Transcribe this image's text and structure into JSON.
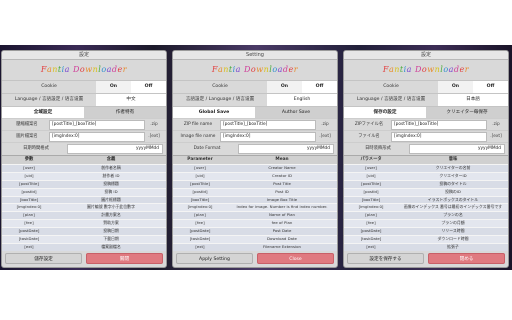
{
  "logo_text": "Fantia Downloader",
  "logo_colors": [
    "#e23c3c",
    "#e88a2a",
    "#d9c21d",
    "#4aab3c",
    "#2f8fd0",
    "#7a4ad0",
    "#d0409a"
  ],
  "panels": [
    {
      "title": "設定",
      "cookie": {
        "label": "Cookie",
        "on": "On",
        "off": "Off"
      },
      "language": {
        "label": "Language / 言語設定 / 语言设置",
        "value": "中文"
      },
      "tabs": {
        "global": "全域設定",
        "author": "作者特有"
      },
      "zip": {
        "label": "壓縮檔案名",
        "value": "[postTitle]_[boxTitle]",
        "ext": ".zip"
      },
      "img": {
        "label": "圖片檔案名",
        "value": "[imgIndex:0]",
        "ext": ".[ext]"
      },
      "date": {
        "label": "日期時間格式",
        "value": "yyyyMMdd"
      },
      "table_head": {
        "param": "參數",
        "meaning": "含義"
      },
      "rows": [
        {
          "param": "[user]",
          "meaning": "創作者名稱"
        },
        {
          "param": "[uid]",
          "meaning": "創作者 ID"
        },
        {
          "param": "[postTitle]",
          "meaning": "投稿標題"
        },
        {
          "param": "[postId]",
          "meaning": "投稿 ID"
        },
        {
          "param": "[boxTitle]",
          "meaning": "圖片框標題"
        },
        {
          "param": "[imgIndex:0]",
          "meaning": "圖片編號 數字小于此位數字"
        },
        {
          "param": "[plan]",
          "meaning": "計畫方案名"
        },
        {
          "param": "[fee]",
          "meaning": "贊助方案"
        },
        {
          "param": "[postDate]",
          "meaning": "投稿日期"
        },
        {
          "param": "[taskDate]",
          "meaning": "下載日期"
        },
        {
          "param": "[ext]",
          "meaning": "檔案副檔名"
        }
      ],
      "buttons": {
        "save": "儲存設定",
        "close": "關閉"
      }
    },
    {
      "title": "Setting",
      "cookie": {
        "label": "Cookie",
        "on": "On",
        "off": "Off"
      },
      "language": {
        "label": "言語設定 / Language / 语言设置",
        "value": "English"
      },
      "tabs": {
        "global": "Global Save",
        "author": "Author Save"
      },
      "zip": {
        "label": "ZIP file name",
        "value": "[postTitle]_[boxTitle]",
        "ext": ".zip"
      },
      "img": {
        "label": "Image file name",
        "value": "[imgIndex:0]",
        "ext": ".[ext]"
      },
      "date": {
        "label": "Date Format",
        "value": "yyyyMMdd"
      },
      "table_head": {
        "param": "Parameter",
        "meaning": "Mean"
      },
      "rows": [
        {
          "param": "[user]",
          "meaning": "Creator Name"
        },
        {
          "param": "[uid]",
          "meaning": "Creator ID"
        },
        {
          "param": "[postTitle]",
          "meaning": "Post Title"
        },
        {
          "param": "[postId]",
          "meaning": "Post ID"
        },
        {
          "param": "[boxTitle]",
          "meaning": "Image Box Title"
        },
        {
          "param": "[imgIndex:0]",
          "meaning": "Index for image. Number is find index number."
        },
        {
          "param": "[plan]",
          "meaning": "Name of Plan"
        },
        {
          "param": "[fee]",
          "meaning": "fee of Plan"
        },
        {
          "param": "[postDate]",
          "meaning": "Post Date"
        },
        {
          "param": "[taskDate]",
          "meaning": "Download Date"
        },
        {
          "param": "[ext]",
          "meaning": "Filename Extension"
        }
      ],
      "buttons": {
        "save": "Apply Setting",
        "close": "Close"
      }
    },
    {
      "title": "設定",
      "cookie": {
        "label": "Cookie",
        "on": "On",
        "off": "Off"
      },
      "language": {
        "label": "Language / 言語設定 / 语言设置",
        "value": "日本語"
      },
      "tabs": {
        "global": "保存の設定",
        "author": "クリエイター毎保存"
      },
      "zip": {
        "label": "ZIPファイル名",
        "value": "[postTitle]_[boxTitle]",
        "ext": ".zip"
      },
      "img": {
        "label": "ファイル名",
        "value": "[imgIndex:0]",
        "ext": ".[ext]"
      },
      "date": {
        "label": "日時装飾形式",
        "value": "yyyyMMdd"
      },
      "table_head": {
        "param": "パラメータ",
        "meaning": "意味"
      },
      "rows": [
        {
          "param": "[user]",
          "meaning": "クリエイターの名前"
        },
        {
          "param": "[uid]",
          "meaning": "クリエイターID"
        },
        {
          "param": "[postTitle]",
          "meaning": "投稿のタイトル"
        },
        {
          "param": "[postId]",
          "meaning": "投稿のID"
        },
        {
          "param": "[boxTitle]",
          "meaning": "イラストボックスのタイトル"
        },
        {
          "param": "[imgIndex:0]",
          "meaning": "画像のインデックス 番号は最初のインデックス番号です"
        },
        {
          "param": "[plan]",
          "meaning": "プランの名"
        },
        {
          "param": "[fee]",
          "meaning": "プランの月額"
        },
        {
          "param": "[postDate]",
          "meaning": "リリース時間"
        },
        {
          "param": "[taskDate]",
          "meaning": "ダウンロード時間"
        },
        {
          "param": "[ext]",
          "meaning": "拡張子"
        }
      ],
      "buttons": {
        "save": "設定を保存する",
        "close": "閉める"
      }
    }
  ]
}
